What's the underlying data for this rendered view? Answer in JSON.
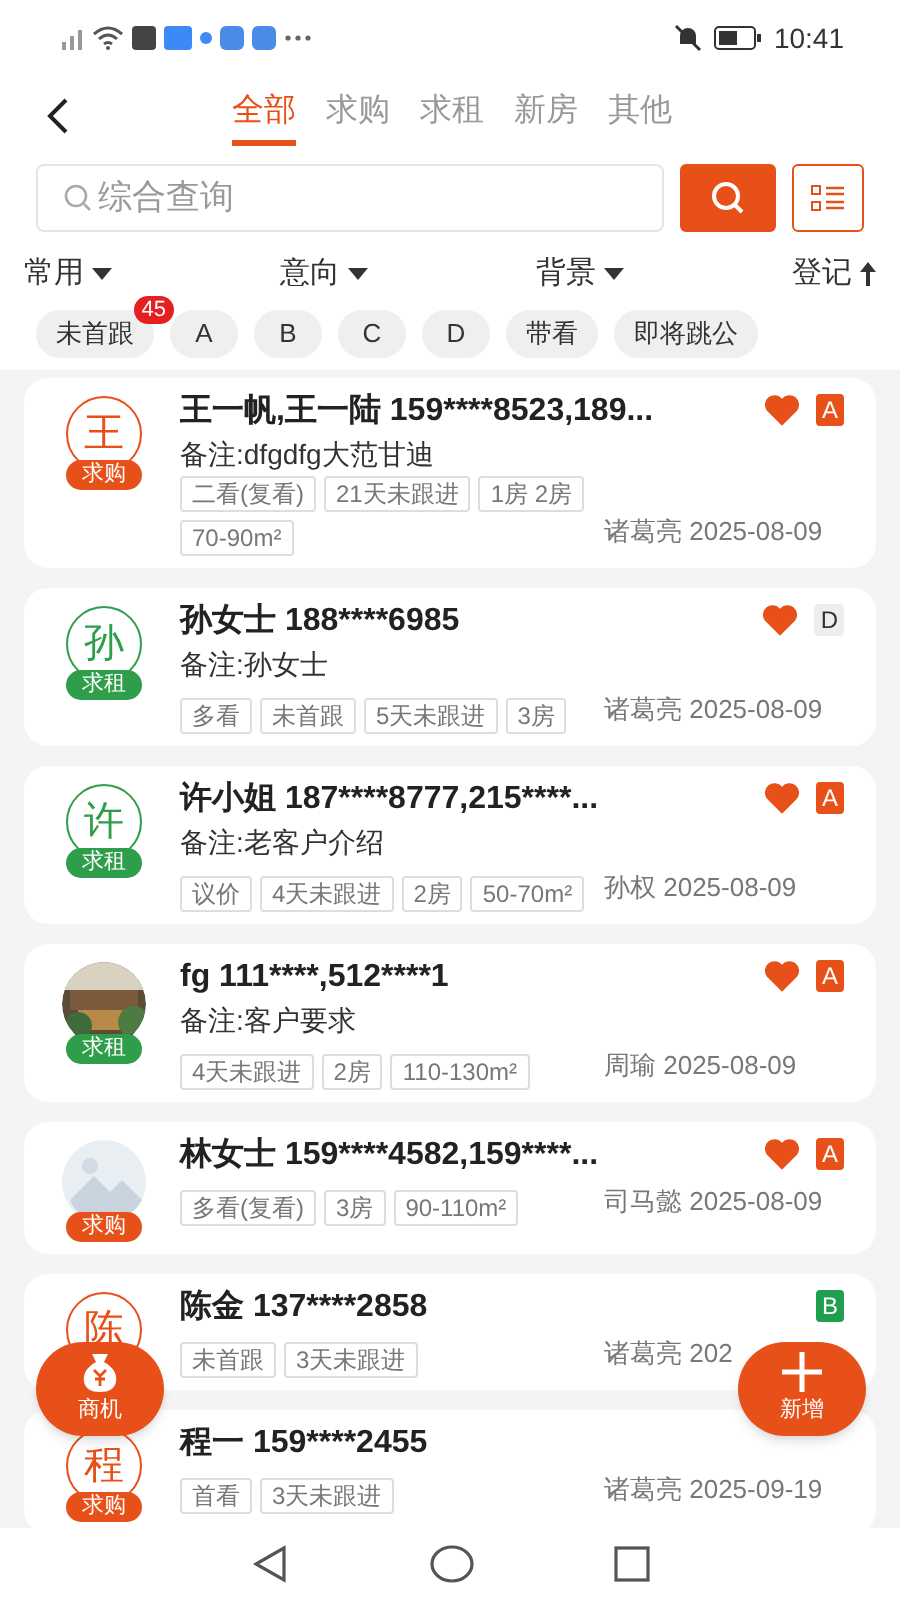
{
  "status_bar": {
    "time": "10:41"
  },
  "tabs": [
    {
      "label": "全部",
      "selected": true
    },
    {
      "label": "求购",
      "selected": false
    },
    {
      "label": "求租",
      "selected": false
    },
    {
      "label": "新房",
      "selected": false
    },
    {
      "label": "其他",
      "selected": false
    }
  ],
  "search": {
    "placeholder": "综合查询"
  },
  "filters": [
    {
      "label": "常用",
      "kind": "dropdown"
    },
    {
      "label": "意向",
      "kind": "dropdown"
    },
    {
      "label": "背景",
      "kind": "dropdown"
    },
    {
      "label": "登记",
      "kind": "sort"
    }
  ],
  "chips": [
    {
      "label": "未首跟",
      "badge": "45"
    },
    {
      "label": "A"
    },
    {
      "label": "B"
    },
    {
      "label": "C"
    },
    {
      "label": "D"
    },
    {
      "label": "带看"
    },
    {
      "label": "即将跳公"
    }
  ],
  "cards": [
    {
      "avatar": {
        "kind": "letter",
        "text": "王"
      },
      "type": {
        "label": "求购",
        "color": "#e8501a"
      },
      "title": "王一帆,王一陆 159****8523,189...",
      "favorite": true,
      "grade": {
        "label": "A",
        "kind": "filled",
        "color": "#e8501a"
      },
      "remark": "备注:dfgdfg大范甘迪",
      "tags": [
        "二看(复看)",
        "21天未跟进",
        "1房 2房",
        "70-90m²"
      ],
      "footer": "诸葛亮 2025-08-09"
    },
    {
      "avatar": {
        "kind": "letter",
        "text": "孙"
      },
      "type": {
        "label": "求租",
        "color": "#2e9e4a"
      },
      "title": "孙女士 188****6985",
      "favorite": true,
      "grade": {
        "label": "D",
        "kind": "plain",
        "color": "#eeeeee"
      },
      "remark": "备注:孙女士",
      "tags": [
        "多看",
        "未首跟",
        "5天未跟进",
        "3房"
      ],
      "footer": "诸葛亮 2025-08-09"
    },
    {
      "avatar": {
        "kind": "letter",
        "text": "许"
      },
      "type": {
        "label": "求租",
        "color": "#2e9e4a"
      },
      "title": "许小姐 187****8777,215****...",
      "favorite": true,
      "grade": {
        "label": "A",
        "kind": "filled",
        "color": "#e8501a"
      },
      "remark": "备注:老客户介绍",
      "tags": [
        "议价",
        "4天未跟进",
        "2房",
        "50-70m²"
      ],
      "footer": "孙权 2025-08-09"
    },
    {
      "avatar": {
        "kind": "picture"
      },
      "type": {
        "label": "求租",
        "color": "#2e9e4a"
      },
      "title": "fg 111****,512****1",
      "favorite": true,
      "grade": {
        "label": "A",
        "kind": "filled",
        "color": "#e8501a"
      },
      "remark": "备注:客户要求",
      "tags": [
        "4天未跟进",
        "2房",
        "110-130m²"
      ],
      "footer": "周瑜 2025-08-09"
    },
    {
      "avatar": {
        "kind": "placeholder"
      },
      "type": {
        "label": "求购",
        "color": "#e8501a"
      },
      "title": "林女士 159****4582,159****...",
      "favorite": true,
      "grade": {
        "label": "A",
        "kind": "filled",
        "color": "#e8501a"
      },
      "tags": [
        "多看(复看)",
        "3房",
        "90-110m²"
      ],
      "footer": "司马懿 2025-08-09"
    },
    {
      "avatar": {
        "kind": "letter",
        "text": "陈"
      },
      "type": {
        "color": "#e8501a"
      },
      "title": "陈金 137****2858",
      "favorite": false,
      "grade": {
        "label": "B",
        "kind": "filled",
        "color": "#1f9e4d"
      },
      "tags": [
        "未首跟",
        "3天未跟进"
      ],
      "footer": "诸葛亮 202"
    },
    {
      "avatar": {
        "kind": "letter",
        "text": "程"
      },
      "type": {
        "label": "求购",
        "color": "#e8501a"
      },
      "title": "程一 159****2455",
      "favorite": false,
      "tags": [
        "首看",
        "3天未跟进"
      ],
      "footer": "诸葛亮 2025-09-19"
    }
  ],
  "fabs": [
    {
      "label": "商机",
      "kind": "money"
    },
    {
      "label": "新增",
      "kind": "add"
    }
  ]
}
